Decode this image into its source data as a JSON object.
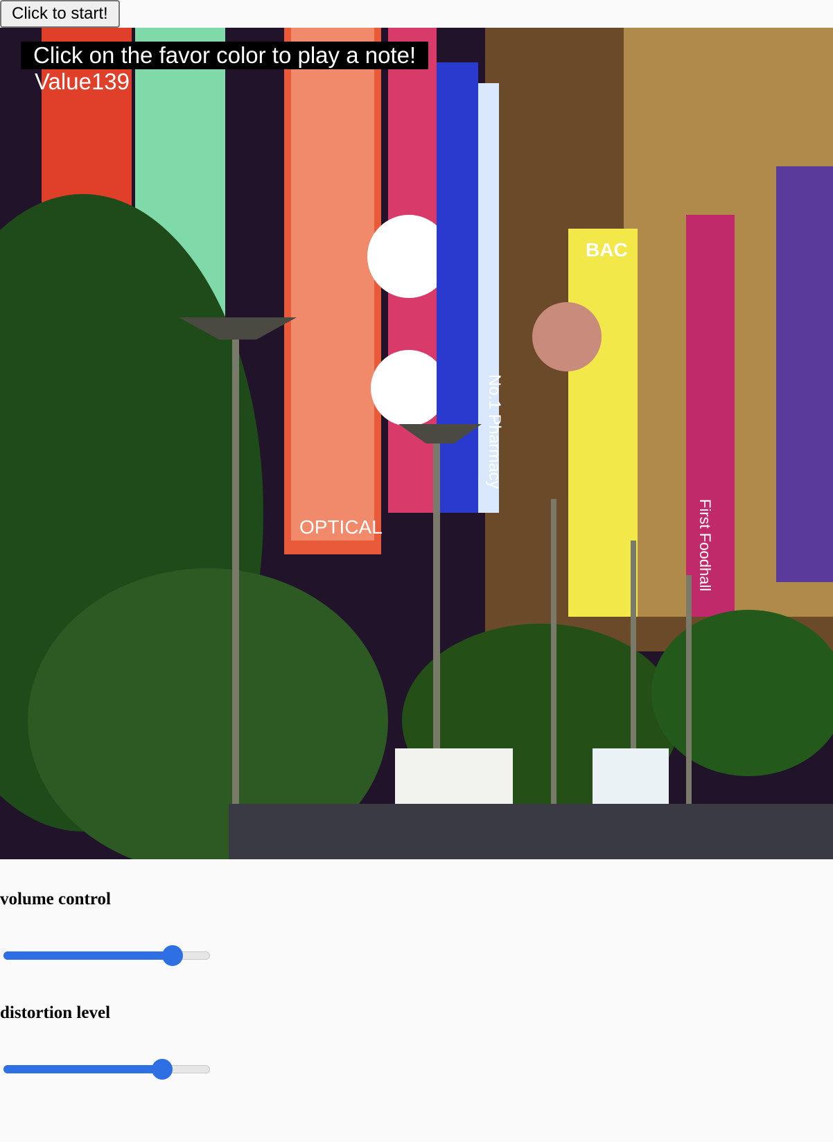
{
  "start_button": {
    "label": "Click to start!"
  },
  "hud": {
    "instruction": "Click on the favor color to play a note!",
    "value_text": "Value139"
  },
  "swatch": {
    "color": "#c98b7c"
  },
  "photo": {
    "sign_text_optical": "OPTICAL",
    "sign_text_pharmacy": "No.1 Pharmacy",
    "sign_text_bac": "BAC",
    "sign_text_foodhall": "First Foodhall"
  },
  "controls": {
    "volume": {
      "label": "volume control",
      "fraction": 0.82
    },
    "distortion": {
      "label": "distortion level",
      "fraction": 0.77
    }
  },
  "colors": {
    "slider_accent": "#2f6fe4"
  }
}
